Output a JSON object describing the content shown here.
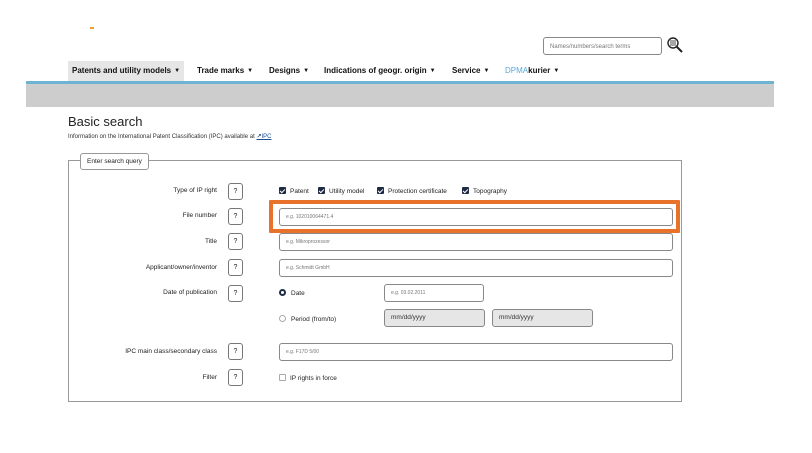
{
  "header": {
    "search_placeholder": "Names/numbers/search terms"
  },
  "nav": {
    "items": [
      {
        "label": "Patents and utility models"
      },
      {
        "label": "Trade marks"
      },
      {
        "label": "Designs"
      },
      {
        "label": "Indications of geogr. origin"
      },
      {
        "label": "Service"
      }
    ],
    "kurier_prefix": "DPMA",
    "kurier_suffix": "kurier",
    "caret": "▼"
  },
  "page": {
    "title": "Basic search",
    "info_text": "Information on the International Patent Classification (IPC) available at",
    "info_link_arrow": "↗",
    "info_link": "IPC"
  },
  "form": {
    "legend": "Enter search query",
    "help_label": "?",
    "type_label": "Type of IP right",
    "types": [
      {
        "label": "Patent",
        "checked": true
      },
      {
        "label": "Utility model",
        "checked": true
      },
      {
        "label": "Protection certificate",
        "checked": true
      },
      {
        "label": "Topography",
        "checked": true
      }
    ],
    "file_number_label": "File number",
    "file_number_placeholder": "e.g. 102010064471.4",
    "title_label": "Title",
    "title_placeholder": "e.g. Mikroprozessor",
    "applicant_label": "Applicant/owner/inventor",
    "applicant_placeholder": "e.g. Schmidt GmbH",
    "date_label": "Date of publication",
    "date_option": "Date",
    "date_placeholder": "e.g. 03.02.2011",
    "period_option": "Period (from/to)",
    "period_from": "mm/dd/yyyy",
    "period_to": "mm/dd/yyyy",
    "ipc_label": "IPC main class/secondary class",
    "ipc_placeholder": "e.g. F17D 5/00",
    "filter_label": "Filter",
    "filter_option": "IP rights in force",
    "filter_checked": false
  },
  "colors": {
    "highlight": "#e8722a",
    "nav_line": "#6fb3d2",
    "checkbox": "#1f2a44",
    "link": "#1d4f8f"
  }
}
